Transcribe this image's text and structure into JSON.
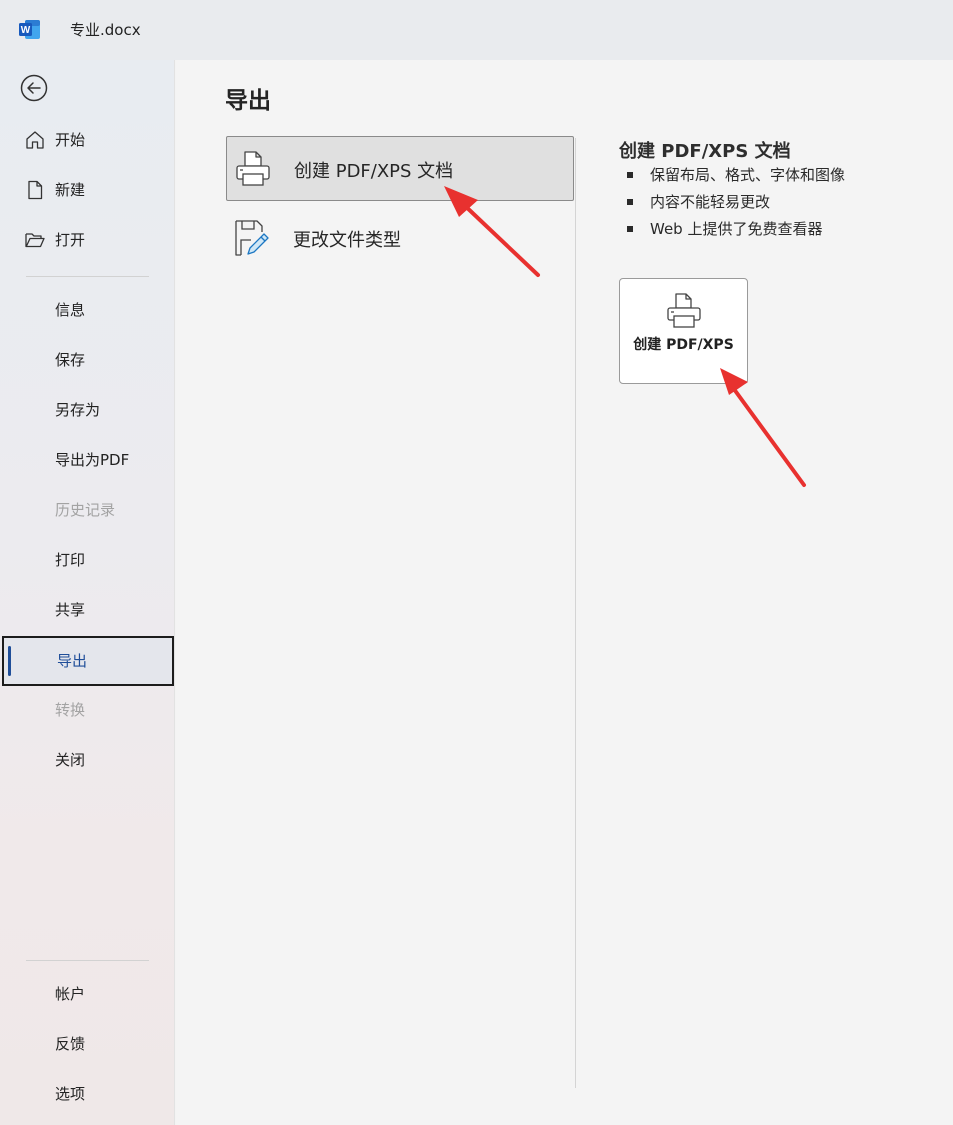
{
  "app": {
    "doc_title": "专业.docx",
    "logo_letter": "W"
  },
  "sidebar": {
    "primary": [
      {
        "label": "开始",
        "icon": "home-icon"
      },
      {
        "label": "新建",
        "icon": "new-document-icon"
      },
      {
        "label": "打开",
        "icon": "open-folder-icon"
      }
    ],
    "items": [
      {
        "label": "信息",
        "state": "normal"
      },
      {
        "label": "保存",
        "state": "normal"
      },
      {
        "label": "另存为",
        "state": "normal"
      },
      {
        "label": "导出为PDF",
        "state": "normal"
      },
      {
        "label": "历史记录",
        "state": "disabled"
      },
      {
        "label": "打印",
        "state": "normal"
      },
      {
        "label": "共享",
        "state": "normal"
      },
      {
        "label": "导出",
        "state": "active"
      },
      {
        "label": "转换",
        "state": "disabled"
      },
      {
        "label": "关闭",
        "state": "normal"
      }
    ],
    "bottom": [
      {
        "label": "帐户"
      },
      {
        "label": "反馈"
      },
      {
        "label": "选项"
      }
    ]
  },
  "main": {
    "title": "导出",
    "options": [
      {
        "label": "创建 PDF/XPS 文档",
        "icon": "printer-document-icon",
        "selected": true
      },
      {
        "label": "更改文件类型",
        "icon": "document-pencil-icon",
        "selected": false
      }
    ],
    "detail": {
      "title": "创建 PDF/XPS 文档",
      "bullets": [
        "保留布局、格式、字体和图像",
        "内容不能轻易更改",
        "Web 上提供了免费查看器"
      ],
      "button_label": "创建 PDF/XPS"
    }
  },
  "colors": {
    "accent": "#1f4e99",
    "annotation_arrow": "#e8312f"
  }
}
